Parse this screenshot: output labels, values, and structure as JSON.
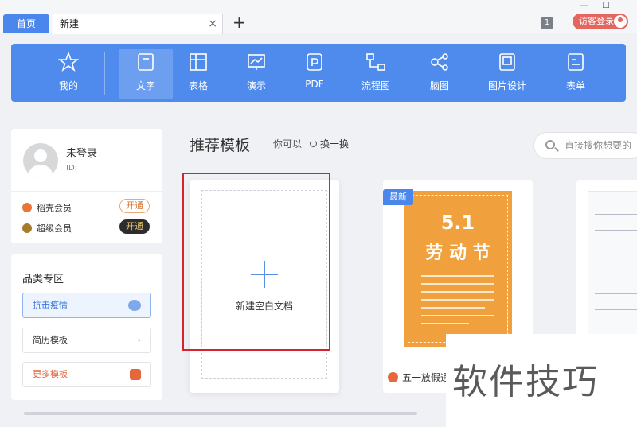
{
  "tabs": {
    "home": "首页",
    "current": "新建",
    "close": "×",
    "add": "+"
  },
  "header": {
    "page_count": "1",
    "login_label": "访客登录",
    "minimize": "—",
    "maximize": "☐"
  },
  "toolbar": {
    "items": [
      {
        "label": "我的",
        "icon": "star-icon"
      },
      {
        "label": "文字",
        "icon": "document-icon",
        "active": true
      },
      {
        "label": "表格",
        "icon": "table-icon"
      },
      {
        "label": "演示",
        "icon": "presentation-icon"
      },
      {
        "label": "PDF",
        "icon": "pdf-icon"
      },
      {
        "label": "流程图",
        "icon": "flowchart-icon"
      },
      {
        "label": "脑图",
        "icon": "mindmap-icon"
      },
      {
        "label": "图片设计",
        "icon": "image-design-icon"
      },
      {
        "label": "表单",
        "icon": "form-icon"
      }
    ]
  },
  "user": {
    "name": "未登录",
    "id_label": "ID:",
    "vip1_label": "稻壳会员",
    "vip1_button": "开通",
    "vip2_label": "超级会员",
    "vip2_button": "开通"
  },
  "categories": {
    "title": "品类专区",
    "items": [
      {
        "label": "抗击疫情"
      },
      {
        "label": "简历模板",
        "tail": "›"
      },
      {
        "label": "更多模板"
      }
    ]
  },
  "main": {
    "section_title": "推荐模板",
    "subtitle": "你可以",
    "refresh_label": "换一换",
    "search_placeholder": "直接搜你想要的",
    "blank_label": "新建空白文档",
    "badge_new": "最新",
    "template_name": "五一放假通",
    "poster_num": "5.1",
    "poster_title": "劳 动 节"
  },
  "watermark": "软件技巧",
  "colors": {
    "accent": "#4f8bed",
    "highlight_border": "#d5232f",
    "poster": "#f0a03d",
    "login": "#e5665e"
  }
}
